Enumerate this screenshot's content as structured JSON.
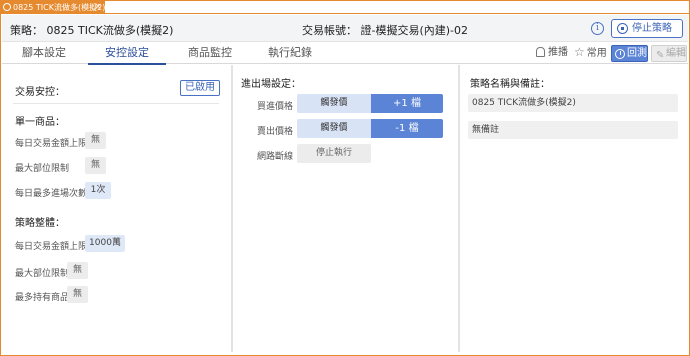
{
  "window": {
    "tab_title": "0825 TICK流做多(模擬2)",
    "close_glyph": "×"
  },
  "header": {
    "strategy": "策略： 0825 TICK流做多(模擬2)",
    "account": "交易帳號： 證-模擬交易(內建)-02",
    "info_glyph": "i",
    "stop_label": "停止策略"
  },
  "tabs": [
    {
      "label": "腳本設定"
    },
    {
      "label": "安控設定"
    },
    {
      "label": "商品監控"
    },
    {
      "label": "執行紀錄"
    }
  ],
  "toolbar": {
    "push_label": "推播",
    "favorite_label": "常用",
    "backtest_label": "回測",
    "edit_label": "編輯",
    "star_glyph": "☆",
    "pencil_glyph": "✎"
  },
  "risk": {
    "title": "交易安控：",
    "enabled_label": "已啟用",
    "single": {
      "title": "單一商品：",
      "rows": [
        {
          "label": "每日交易金額上限",
          "value": "無"
        },
        {
          "label": "最大部位限制",
          "value": "無"
        },
        {
          "label": "每日最多進場次數",
          "value": "1次"
        }
      ]
    },
    "overall": {
      "title": "策略整體：",
      "rows": [
        {
          "label": "每日交易金額上限",
          "value": "1000萬"
        },
        {
          "label": "最大部位限制",
          "value": "無"
        },
        {
          "label": "最多持有商品",
          "value": "無"
        }
      ]
    }
  },
  "entry": {
    "title": "進出場設定：",
    "buy": {
      "label": "買進價格",
      "price": "觸發價",
      "tick": "+1 檔"
    },
    "sell": {
      "label": "賣出價格",
      "price": "觸發價",
      "tick": "-1 檔"
    },
    "disconnect": {
      "label": "網路斷線",
      "action": "停止執行"
    }
  },
  "note": {
    "title": "策略名稱與備註：",
    "name": "0825 TICK流做多(模擬2)",
    "remark": "無備註"
  },
  "colors": {
    "accent_orange": "#e58a2e",
    "primary_blue": "#5b84d6",
    "active_tab": "#2b4f9b"
  }
}
